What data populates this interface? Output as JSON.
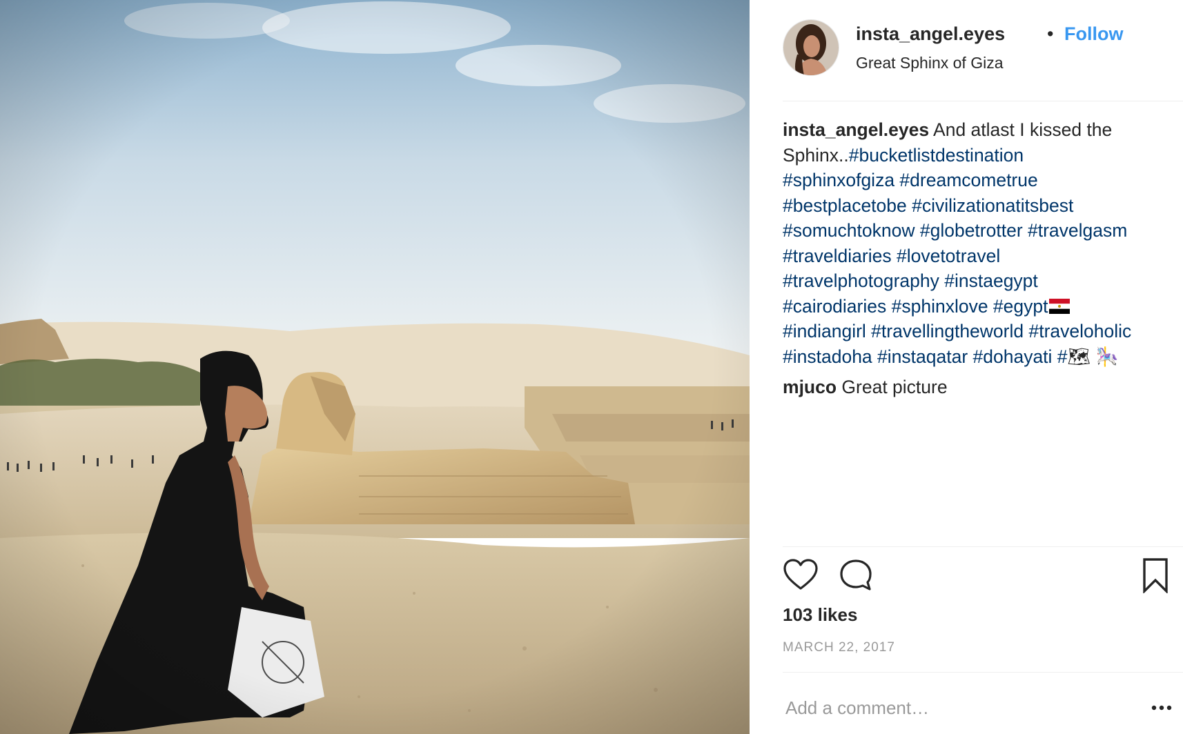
{
  "post": {
    "username": "insta_angel.eyes",
    "separator": "•",
    "follow_label": "Follow",
    "location": "Great Sphinx of Giza",
    "caption": {
      "username": "insta_angel.eyes",
      "text": "And atlast I kissed the Sphinx..",
      "hashtags_line1": "#bucketlistdestination",
      "hashtags_line2": "#sphinxofgiza #dreamcometrue",
      "hashtags_line3": "#bestplacetobe #civilizationatitsbest",
      "hashtags_line4": "#somuchtoknow #globetrotter #travelgasm",
      "hashtags_line5": "#traveldiaries #lovetotravel",
      "hashtags_line6": "#travelphotography #instaegypt",
      "hashtags_line7": "#cairodiaries #sphinxlove #egypt",
      "hashtags_line8": "#indiangirl #travellingtheworld #traveloholic",
      "hashtags_line9": "#instadoha #instaqatar #dohayati #",
      "emoji": "🗺 🎠"
    },
    "comments": [
      {
        "username": "mjuco",
        "text": "Great picture"
      }
    ],
    "likes": "103 likes",
    "date": "MARCH 22, 2017",
    "add_comment_placeholder": "Add a comment…"
  },
  "icons": {
    "like": "heart-icon",
    "comment": "comment-bubble-icon",
    "save": "bookmark-icon",
    "more": "more-options-icon",
    "flag": "egypt-flag-icon"
  },
  "colors": {
    "link": "#3897f0",
    "hashtag": "#003569",
    "muted": "#999999",
    "text": "#262626"
  }
}
